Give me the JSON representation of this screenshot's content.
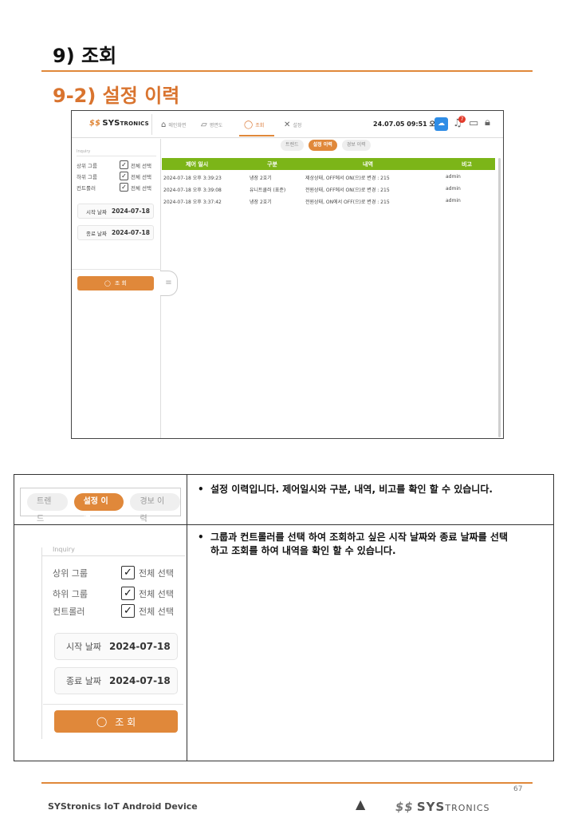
{
  "heading1": "9) 조회",
  "heading2": "9-2)  설정 이력",
  "app": {
    "logo_main": "SYS",
    "logo_tail": "TRONICS",
    "nav": [
      {
        "label": "메인화면",
        "icon": "⌂"
      },
      {
        "label": "평면도",
        "icon": "▱"
      },
      {
        "label": "조회",
        "icon": "◯"
      },
      {
        "label": "설정",
        "icon": "✕"
      }
    ],
    "clock": "24.07.05 09:51 오전",
    "notification_count": "7",
    "inquiry": {
      "title": "Inquiry",
      "rows": [
        {
          "label": "상위 그룹",
          "check": "✓",
          "all": "전체 선택"
        },
        {
          "label": "하위 그룹",
          "check": "✓",
          "all": "전체 선택"
        },
        {
          "label": "컨트롤러",
          "check": "✓",
          "all": "전체 선택"
        }
      ],
      "start_label": "시작 날짜",
      "start_value": "2024-07-18",
      "end_label": "종료 날짜",
      "end_value": "2024-07-18",
      "search_label": "조 회"
    },
    "tabs": [
      "트렌드",
      "설정 이력",
      "경보 이력"
    ],
    "table": {
      "columns": [
        "제어 일시",
        "구분",
        "내역",
        "비고"
      ],
      "rows": [
        [
          "2024-07-18 오후 3:39:23",
          "냉장 2호기",
          "제상상태, OFF에서 ON(으)로 변경 : 215",
          "admin"
        ],
        [
          "2024-07-18 오후 3:39:08",
          "유니트쿨러 (표준)",
          "전원상태, OFF에서 ON(으)로 변경 : 215",
          "admin"
        ],
        [
          "2024-07-18 오후 3:37:42",
          "냉장 2호기",
          "전원상태, ON에서 OFF(으)로 변경 : 215",
          "admin"
        ]
      ]
    }
  },
  "desc": {
    "row1_text": "설정 이력입니다. 제어일시와 구분, 내역, 비고를 확인 할 수 있습니다.",
    "row2_text_line1": "그룹과 컨트롤러를 선택 하여 조회하고 싶은 시작 날짜와 종료 날짜를 선택",
    "row2_text_line2": "하고 조회를 하여 내역을 확인 할 수 있습니다.",
    "bullet": "•"
  },
  "footer": {
    "page": "67",
    "left": "SYStronics IoT Android Device",
    "logo_main": "SYS",
    "logo_tail": "TRONICS"
  },
  "colors": {
    "accent": "#e0883a",
    "heading2": "#d9742f",
    "table_header": "#7cb518"
  }
}
